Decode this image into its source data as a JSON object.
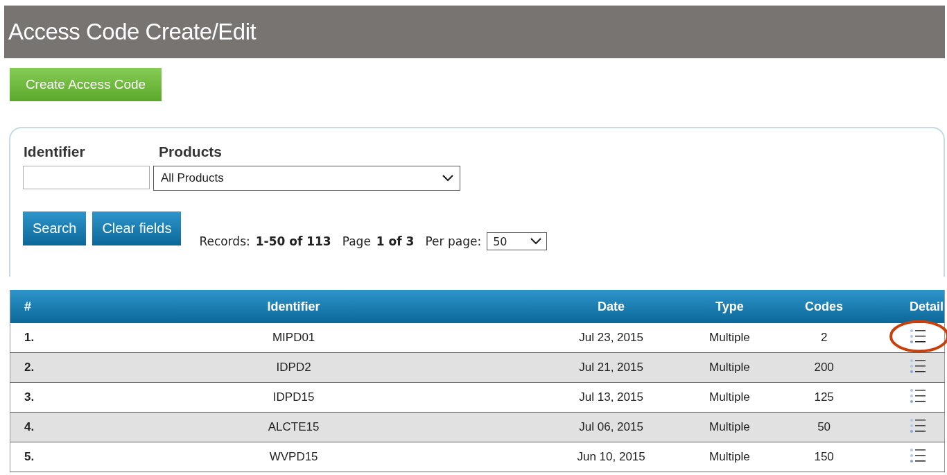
{
  "header": {
    "title": "Access Code Create/Edit"
  },
  "create_button": "Create Access Code",
  "filters": {
    "identifier": {
      "label": "Identifier"
    },
    "products": {
      "label": "Products",
      "value": "All Products"
    }
  },
  "buttons": [
    "Search",
    "Clear fields"
  ],
  "records": {
    "records_label": "Records:",
    "records_value": "1-50 of 113",
    "page_label": "Page",
    "page_value": "1 of 3",
    "per_page_label": "Per page:",
    "per_page_value": "50"
  },
  "table": {
    "columns": [
      "#",
      "Identifier",
      "Date",
      "Type",
      "Codes",
      "Detail"
    ],
    "rows": [
      {
        "number": "1.",
        "identifier": "MIPD01",
        "date": "Jul 23, 2015",
        "type": "Multiple",
        "codes": "2",
        "circled": true
      },
      {
        "number": "2.",
        "identifier": "IDPD2",
        "date": "Jul 21, 2015",
        "type": "Multiple",
        "codes": "200",
        "circled": false
      },
      {
        "number": "3.",
        "identifier": "IDPD15",
        "date": "Jul 13, 2015",
        "type": "Multiple",
        "codes": "125",
        "circled": false
      },
      {
        "number": "4.",
        "identifier": "ALCTE15",
        "date": "Jul 06, 2015",
        "type": "Multiple",
        "codes": "50",
        "circled": false
      },
      {
        "number": "5.",
        "identifier": "WVPD15",
        "date": "Jun 10, 2015",
        "type": "Multiple",
        "codes": "150",
        "circled": false
      }
    ]
  }
}
